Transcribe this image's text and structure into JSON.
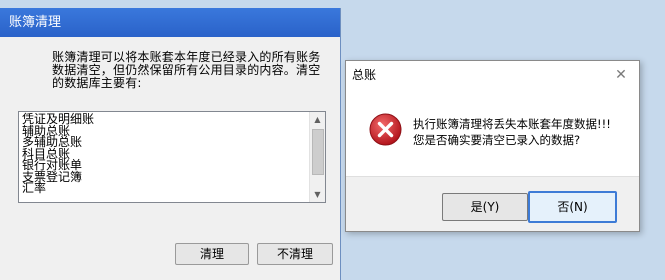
{
  "back_window": {
    "title": "账簿清理",
    "intro_line1": "账簿清理可以将本账套本年度已经录入的所有账务",
    "intro_line2": "数据清空，但仍然保留所有公用目录的内容。清空",
    "intro_line3": "的数据库主要有:",
    "list_items": [
      "凭证及明细账",
      "辅助总账",
      "多辅助总账",
      "科目总账",
      "银行对账单",
      "支票登记簿",
      "汇率"
    ],
    "clean_button": "清理",
    "no_clean_button": "不清理"
  },
  "dialog": {
    "title": "总账",
    "message_line1": "执行账簿清理将丢失本账套年度数据!!!",
    "message_line2": "您是否确实要清空已录入的数据?",
    "yes_button": "是(Y)",
    "no_button": "否(N)",
    "close_glyph": "✕"
  },
  "colors": {
    "desktop": "#c6d9ec",
    "titlebar": "#2e6bd3",
    "error_red": "#d0202a",
    "focus_border": "#3d7bd6"
  }
}
